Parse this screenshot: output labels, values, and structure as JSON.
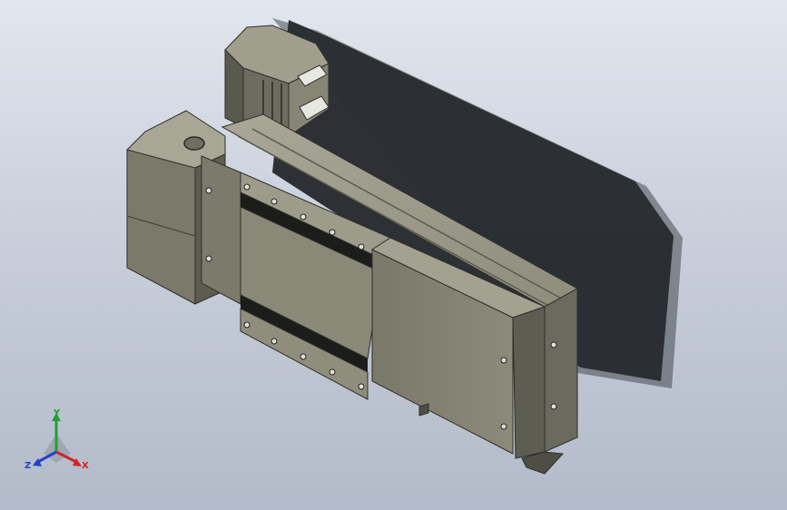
{
  "colors": {
    "background_top": "#e2e6ee",
    "background_bottom": "#b3bac9",
    "body_dark": "#4a4a42",
    "body_mid": "#7c7b6c",
    "body_light": "#a7a695",
    "shadow": "#25272c",
    "axis_x": "#d4202a",
    "axis_y": "#1fa12f",
    "axis_z": "#2440c8"
  },
  "triad": {
    "x_label": "X",
    "y_label": "Y",
    "z_label": "Z"
  },
  "model": {
    "icons": {
      "motor": "stepper-motor-icon",
      "actuator": "linear-module-icon"
    }
  }
}
